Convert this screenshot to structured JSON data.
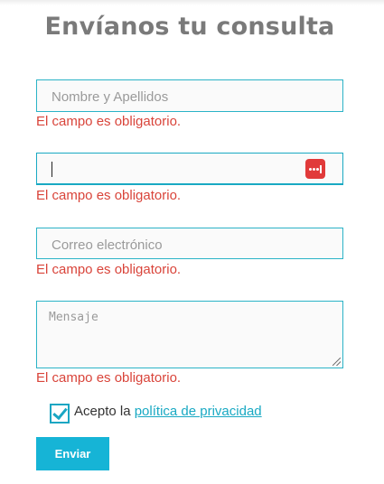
{
  "form": {
    "title": "Envíanos tu consulta",
    "fields": {
      "name_placeholder": "Nombre y Apellidos",
      "phone_value": "",
      "email_placeholder": "Correo electrónico",
      "message_placeholder": "Mensaje"
    },
    "error_message": "El campo es obligatorio.",
    "consent": {
      "checked": true,
      "prefix": "Acepto la",
      "link_text": "política de privacidad"
    },
    "submit_label": "Enviar",
    "password_manager_icon": "password-dots-icon",
    "colors": {
      "accent": "#16b4d6",
      "error": "#d9443a",
      "title": "#7a7a7a",
      "icon_red": "#e13a3a"
    }
  }
}
